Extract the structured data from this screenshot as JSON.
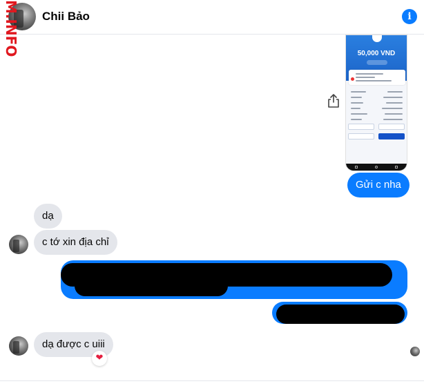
{
  "watermark": "M.INFO",
  "header": {
    "contact_name": "Chii Bảo",
    "info_icon": "info-icon",
    "info_glyph": "i"
  },
  "image_message": {
    "amount": "50,000 VND",
    "icon": "bank-transfer-screenshot"
  },
  "messages": {
    "out_1": "Gửi c nha",
    "in_1": "dạ",
    "in_2": "c tớ xin địa chỉ",
    "in_3": "dạ được c uiii"
  },
  "reaction": {
    "emoji": "❤",
    "icon": "heart-icon"
  },
  "colors": {
    "accent": "#0a7cff",
    "incoming_bubble": "#e4e6eb",
    "watermark": "#e0181f"
  }
}
